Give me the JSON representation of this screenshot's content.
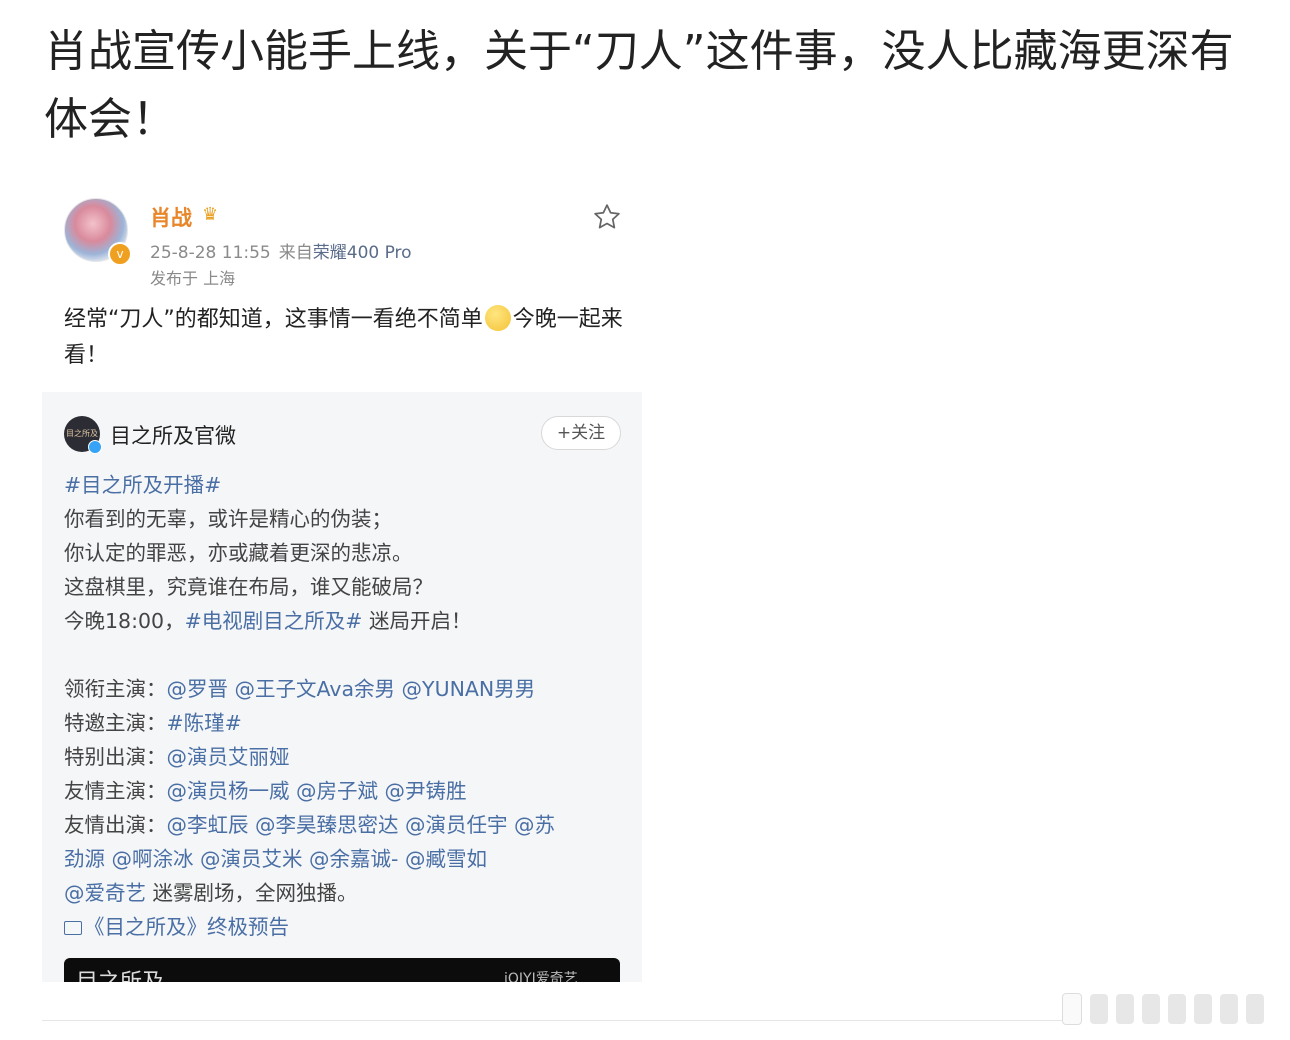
{
  "article": {
    "headline": "肖战宣传小能手上线，关于“刀人”这件事，没人比藏海更深有体会！"
  },
  "post": {
    "author": "肖战",
    "timestamp": "25-8-28 11:55",
    "source_prefix": "来自",
    "device": "荣耀400 Pro",
    "location": "发布于 上海",
    "text_before_emoji": "经常“刀人”的都知道，这事情一看绝不简单",
    "text_after_emoji": "今晚一起来看！"
  },
  "repost": {
    "account": "目之所及官微",
    "avatar_text": "目之所及",
    "follow_label": "+关注",
    "hashtag_title": "#目之所及开播#",
    "lines": [
      "你看到的无辜，或许是精心的伪装；",
      "你认定的罪恶，亦或藏着更深的悲凉。",
      "这盘棋里，究竟谁在布局，谁又能破局？"
    ],
    "tonight_prefix": "今晚18:00，",
    "tonight_tag": "#电视剧目之所及#",
    "tonight_suffix": " 迷局开启！",
    "lead_label": "领衔主演：",
    "lead_names": "@罗晋 @王子文Ava余男 @YUNAN男男",
    "special_label": "特邀主演：",
    "special_names": "#陈瑾#",
    "special_app_label": "特别出演：",
    "special_app_names": "@演员艾丽娅",
    "friend_lead_label": "友情主演：",
    "friend_lead_names": "@演员杨一威 @房子斌 @尹铸胜",
    "friend_app_label": "友情出演：",
    "friend_app_names_1": "@李虹辰 @李昊臻思密达 @演员任宇 @苏",
    "friend_app_names_2": "劲源 @啊涂冰 @演员艾米 @余嘉诚- @臧雪如",
    "platform_name": "@爱奇艺",
    "platform_text": " 迷雾剧场，全网独播。",
    "video_link": "《目之所及》终极预告",
    "video_title": "目之所及",
    "video_logo": "iQIYI爱奇艺"
  }
}
